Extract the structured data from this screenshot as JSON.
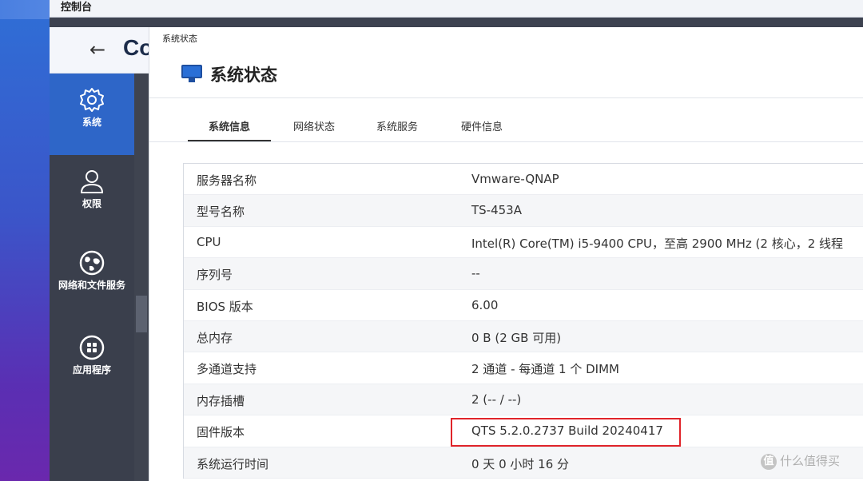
{
  "window": {
    "title": "控制台"
  },
  "control_panel": {
    "back_icon": "back-arrow-icon",
    "title_peek": "Co"
  },
  "sidebar": {
    "items": [
      {
        "label": "系统",
        "icon": "gear-icon",
        "active": true
      },
      {
        "label": "权限",
        "icon": "user-icon",
        "active": false
      },
      {
        "label": "网络和文件服务",
        "icon": "globe-icon",
        "active": false
      },
      {
        "label": "应用程序",
        "icon": "apps-grid-icon",
        "active": false
      }
    ]
  },
  "panel": {
    "caption": "系统状态",
    "heading": "系统状态",
    "heading_icon": "monitor-icon",
    "tabs": [
      {
        "label": "系统信息",
        "active": true
      },
      {
        "label": "网络状态",
        "active": false
      },
      {
        "label": "系统服务",
        "active": false
      },
      {
        "label": "硬件信息",
        "active": false
      }
    ],
    "rows": [
      {
        "key": "服务器名称",
        "value": "Vmware-QNAP"
      },
      {
        "key": "型号名称",
        "value": "TS-453A"
      },
      {
        "key": "CPU",
        "value": "Intel(R) Core(TM) i5-9400 CPU，至高 2900 MHz (2 核心，2 线程"
      },
      {
        "key": "序列号",
        "value": "--"
      },
      {
        "key": "BIOS 版本",
        "value": "6.00"
      },
      {
        "key": "总内存",
        "value": "0 B (2 GB 可用)"
      },
      {
        "key": "多通道支持",
        "value": "2 通道 - 每通道 1 个 DIMM"
      },
      {
        "key": "内存插槽",
        "value": "2 (-- / --)"
      },
      {
        "key": "固件版本",
        "value": "QTS 5.2.0.2737 Build 20240417"
      },
      {
        "key": "系统运行时间",
        "value": "0 天 0 小时 16 分"
      }
    ],
    "highlight_color": "#e0242a"
  },
  "watermark": {
    "text": "什么值得买",
    "badge": "值"
  },
  "colors": {
    "sidebar_bg": "#3a3f4c",
    "sidebar_active": "#2e66c8"
  }
}
